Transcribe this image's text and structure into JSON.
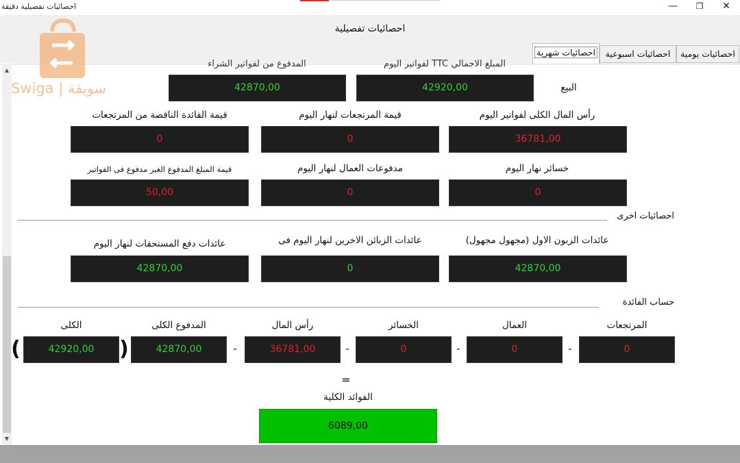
{
  "window": {
    "title": "احصائيات تفصيلية دقيقة",
    "minimize": "—",
    "restore": "❐",
    "close": "✕"
  },
  "header": {
    "title": "احصائيات تفصيلية"
  },
  "tabs": [
    {
      "label": "احصائيات يومية"
    },
    {
      "label": "احصائيات اسبوعية"
    },
    {
      "label": "احصائيات شهرية"
    }
  ],
  "watermark": {
    "text": "Swiga | سويقة"
  },
  "sales": {
    "label": "البيع",
    "top_label_right": "المبلغ الاجمالي TTC لفواتير اليوم",
    "top_label_left": "المدفوع من لفواتير الشراء",
    "total_ttc": "42920,00",
    "paid": "42870,00"
  },
  "row2": {
    "capital_label": "رأس المال الكلى لفواتير اليوم",
    "capital_value": "36781,00",
    "returns_label": "قيمة المرتجعات لنهار اليوم",
    "returns_value": "0",
    "returns_profit_label": "قيمة الفائدة الناقصة من المرتجعات",
    "returns_profit_value": "0"
  },
  "row3": {
    "losses_label": "خسائر نهار اليوم",
    "losses_value": "0",
    "workers_label": "مدفوعات العمال لنهار اليوم",
    "workers_value": "0",
    "unpaid_label": "قيمة المبلغ المدفوع الغير مدفوع فى الفواتير",
    "unpaid_value": "50,00"
  },
  "other_stats": {
    "title": "احصائيات اخرى",
    "first_customer_label": "عائدات الزبون الاول (مجهول مجهول)",
    "first_customer_value": "42870,00",
    "other_customers_label": "عائدات الزبائن الاخرين لنهار اليوم فى",
    "other_customers_value": "0",
    "dues_label": "عائدات دفع المستحقات لنهار اليوم",
    "dues_value": "42870,00"
  },
  "profit_calc": {
    "title": "حساب الفائدة",
    "returns_label": "المرتجعات",
    "returns_value": "0",
    "workers_label": "العمال",
    "workers_value": "0",
    "losses_label": "الخسائر",
    "losses_value": "0",
    "capital_label": "رأس المال",
    "capital_value": "36781,00",
    "paid_total_label": "المدفوع الكلى",
    "paid_total_value": "42870,00",
    "total_label": "الكلى",
    "total_value": "42920,00",
    "minus": "-",
    "open_paren": "(",
    "close_paren": ")",
    "equals": "=",
    "net_label": "الفوائد الكلية",
    "net_value": "6089,00"
  },
  "colors": {
    "value_red": "#e0202a",
    "value_green": "#2fd435",
    "result_green": "#00c000",
    "box_bg": "#1e1e1e"
  }
}
